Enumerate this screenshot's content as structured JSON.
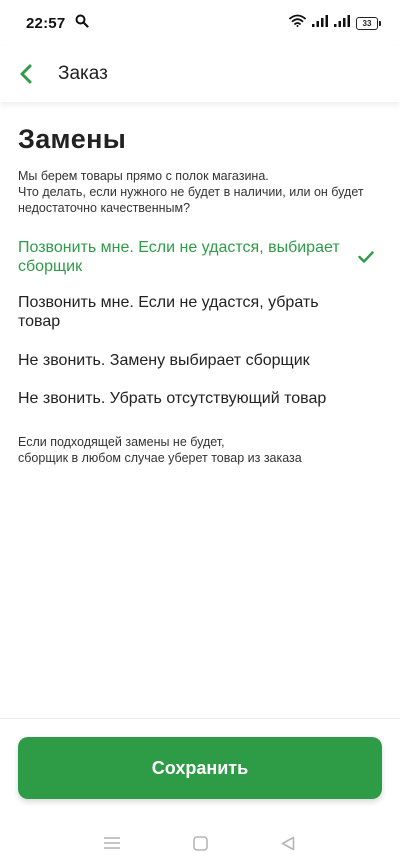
{
  "status_bar": {
    "time": "22:57",
    "battery": "33"
  },
  "app_bar": {
    "title": "Заказ"
  },
  "page": {
    "title": "Замены",
    "description": "Мы берем товары прямо с полок магазина.\nЧто делать, если нужного не будет в наличии, или он будет недостаточно качественным?",
    "options": [
      {
        "label": "Позвонить мне. Если не удастся, выбирает сборщик",
        "selected": true
      },
      {
        "label": "Позвонить мне. Если не удастся, убрать товар",
        "selected": false
      },
      {
        "label": "Не звонить. Замену выбирает сборщик",
        "selected": false
      },
      {
        "label": "Не звонить. Убрать отсутствующий товар",
        "selected": false
      }
    ],
    "footnote": "Если подходящей замены не будет,\nсборщик в любом случае уберет товар из заказа"
  },
  "actions": {
    "save_label": "Сохранить"
  },
  "colors": {
    "accent": "#2e9c47",
    "text": "#222222"
  },
  "icons": {
    "back": "chevron-left-icon",
    "check": "checkmark-icon",
    "nav_menu": "menu-icon",
    "nav_home": "square-icon",
    "nav_back": "triangle-back-icon"
  }
}
